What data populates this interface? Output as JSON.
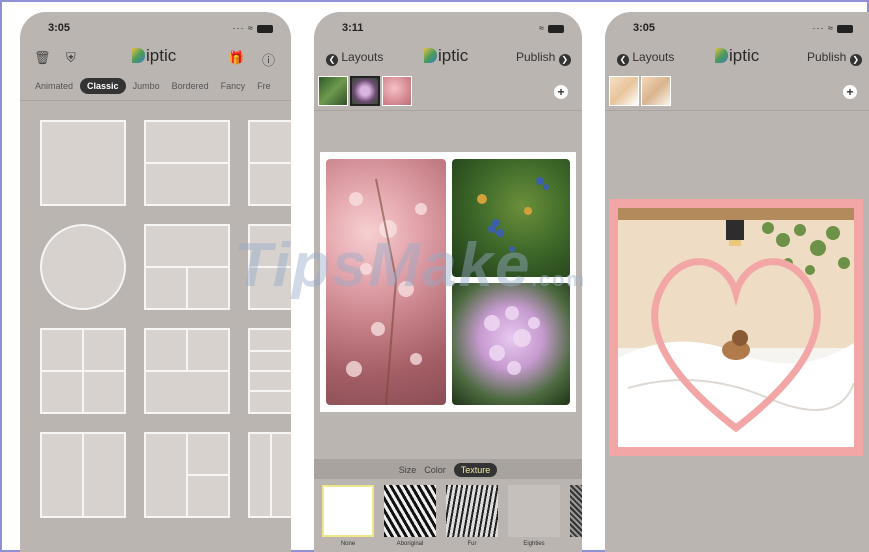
{
  "phone1": {
    "time": "3:05",
    "title": "iptic",
    "tabs": [
      "Animated",
      "Classic",
      "Jumbo",
      "Bordered",
      "Fancy",
      "Fre"
    ],
    "active_tab": "Classic"
  },
  "phone2": {
    "time": "3:11",
    "back_label": "Layouts",
    "title": "iptic",
    "publish_label": "Publish",
    "bottom_tabs": [
      "Size",
      "Color",
      "Texture"
    ],
    "active_bottom_tab": "Texture",
    "textures": [
      "None",
      "Aboriginal",
      "Fur",
      "Eighties"
    ]
  },
  "phone3": {
    "time": "3:05",
    "back_label": "Layouts",
    "title": "iptic",
    "publish_label": "Publish"
  },
  "watermark": {
    "text": "TipsMake",
    "suffix": ".com"
  },
  "icons": [
    "trash-icon",
    "shield-icon",
    "gift-icon",
    "help-icon",
    "chevron-left-icon",
    "chevron-right-icon",
    "plus-icon",
    "wifi-icon",
    "battery-icon"
  ],
  "colors": {
    "background": "#bab5b1",
    "frame_pink": "#f2a6a6",
    "layout_stroke": "#f5f5f5",
    "active_tab": "#333333"
  }
}
